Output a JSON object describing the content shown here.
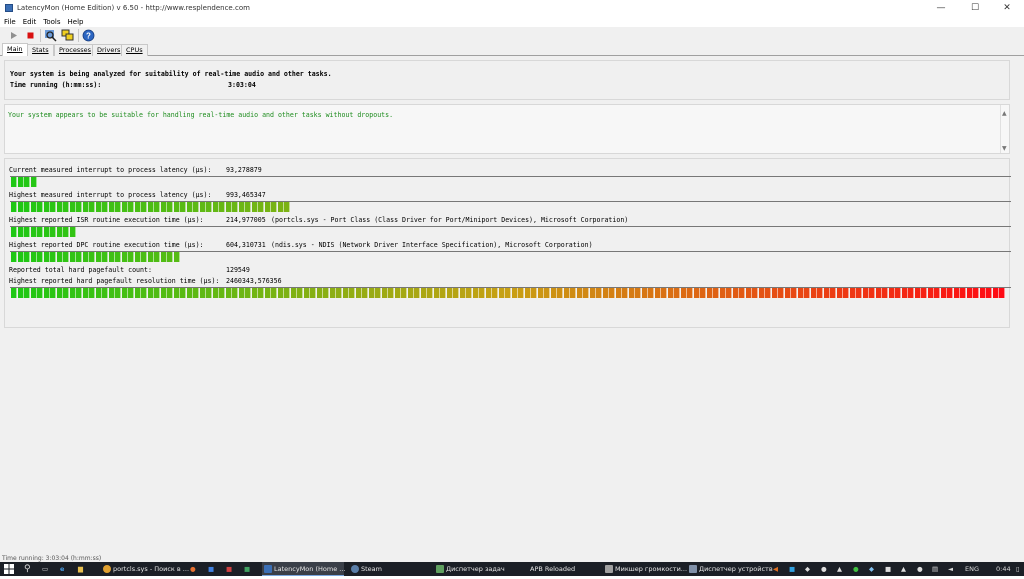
{
  "window": {
    "title": "LatencyMon  (Home Edition)  v 6.50 - http://www.resplendence.com",
    "minimize": "—",
    "maximize": "☐",
    "close": "✕"
  },
  "menu": [
    "File",
    "Edit",
    "Tools",
    "Help"
  ],
  "tabs": [
    "Main",
    "Stats",
    "Processes",
    "Drivers",
    "CPUs"
  ],
  "analysis": {
    "line1": "Your system is being analyzed for suitability of real-time audio and other tasks.",
    "time_label": "Time running (h:mm:ss):",
    "time_value": "3:03:04"
  },
  "status_message": "Your system appears to be suitable for handling real-time audio and other tasks without dropouts.",
  "metrics": [
    {
      "label": "Current measured interrupt to process latency (µs):",
      "value": "93,278879",
      "driver": "",
      "fraction": 0.027
    },
    {
      "label": "Highest measured interrupt to process latency (µs):",
      "value": "993,465347",
      "driver": "",
      "fraction": 0.28
    },
    {
      "label": "Highest reported ISR routine execution time (µs):",
      "value": "214,977005",
      "driver": "(portcls.sys - Port Class (Class Driver for Port/Miniport Devices), Microsoft Corporation)",
      "fraction": 0.064
    },
    {
      "label": "Highest reported DPC routine execution time (µs):",
      "value": "604,310731",
      "driver": "(ndis.sys - NDIS (Network Driver Interface Specification), Microsoft Corporation)",
      "fraction": 0.172
    }
  ],
  "pagefault": {
    "count_label": "Reported total hard pagefault count:",
    "count_value": "129549",
    "res_label": "Highest reported hard pagefault resolution time (µs):",
    "res_value": "2460343,576356",
    "fraction": 1.0
  },
  "bottom_status": "Time running: 3:03:04 (h:mm:ss)",
  "taskbar": {
    "items": [
      {
        "label": "portcls.sys - Поиск в ..."
      },
      {
        "label": "LatencyMon  (Home ..."
      },
      {
        "label": "Steam"
      },
      {
        "label": "Диспетчер задач"
      },
      {
        "label": "APB Reloaded"
      },
      {
        "label": "Микшер громкости..."
      },
      {
        "label": "Диспетчер устройств"
      }
    ],
    "lang": "ENG",
    "clock": "0:44"
  }
}
